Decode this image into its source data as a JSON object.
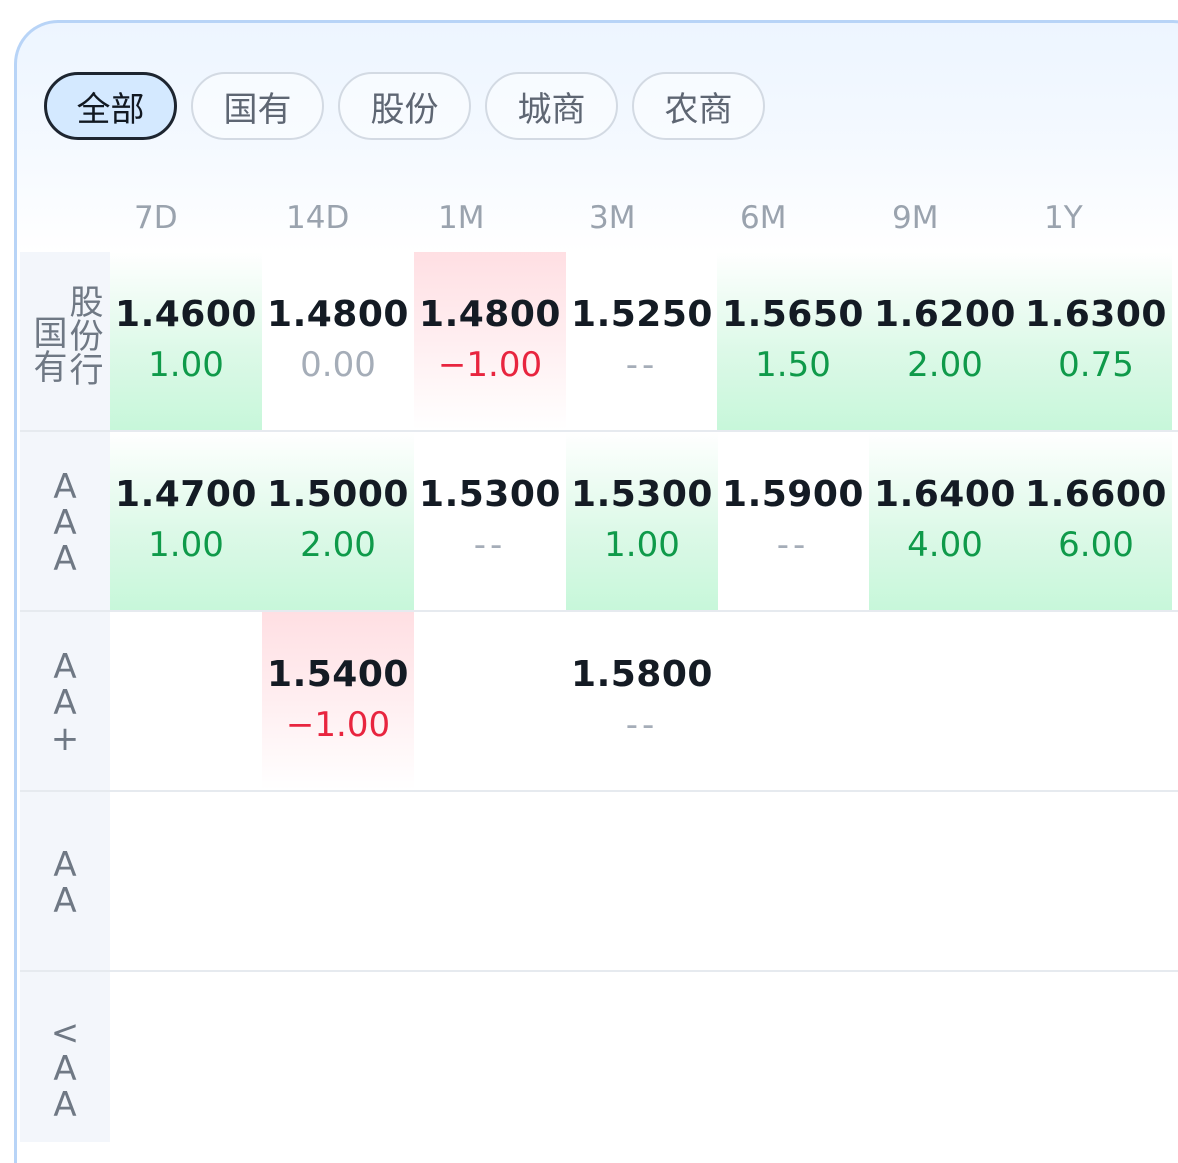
{
  "filters": {
    "all": "全部",
    "state": "国有",
    "joint": "股份",
    "city": "城商",
    "rural": "农商"
  },
  "tenors": [
    "7D",
    "14D",
    "1M",
    "3M",
    "6M",
    "9M",
    "1Y"
  ],
  "rows": [
    {
      "label_cn": [
        "国有",
        "股份行"
      ],
      "cells": [
        {
          "rate": "1.4600",
          "change": "1.00"
        },
        {
          "rate": "1.4800",
          "change": "0.00"
        },
        {
          "rate": "1.4800",
          "change": "-1.00"
        },
        {
          "rate": "1.5250",
          "change": "--"
        },
        {
          "rate": "1.5650",
          "change": "1.50"
        },
        {
          "rate": "1.6200",
          "change": "2.00"
        },
        {
          "rate": "1.6300",
          "change": "0.75"
        }
      ]
    },
    {
      "label": "AAA",
      "cells": [
        {
          "rate": "1.4700",
          "change": "1.00"
        },
        {
          "rate": "1.5000",
          "change": "2.00"
        },
        {
          "rate": "1.5300",
          "change": "--"
        },
        {
          "rate": "1.5300",
          "change": "1.00"
        },
        {
          "rate": "1.5900",
          "change": "--"
        },
        {
          "rate": "1.6400",
          "change": "4.00"
        },
        {
          "rate": "1.6600",
          "change": "6.00"
        }
      ]
    },
    {
      "label": "AA+",
      "cells": [
        {
          "rate": "1.5400",
          "change": "-1.00",
          "tenor": "14D"
        },
        {
          "rate": "1.5800",
          "change": "--",
          "tenor": "3M"
        }
      ]
    },
    {
      "label": "AA",
      "cells": []
    },
    {
      "label": "<AA",
      "cells": []
    }
  ],
  "colors": {
    "up": "#0f9a4a",
    "down": "#e8253f",
    "neutral": "#a5adb8",
    "active_tab_bg": "#d4e9ff"
  }
}
